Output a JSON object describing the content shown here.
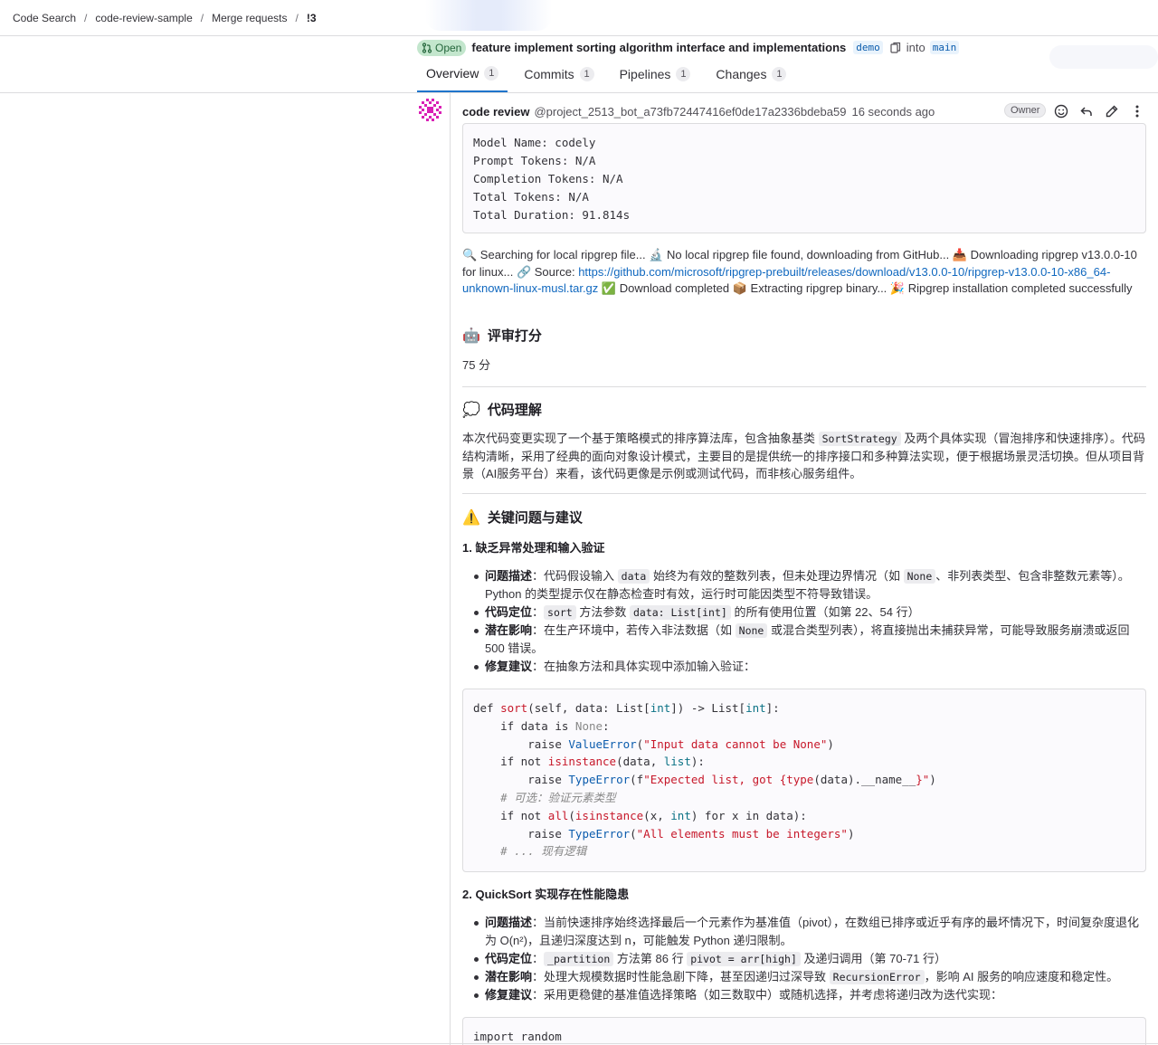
{
  "breadcrumb": [
    "Code Search",
    "code-review-sample",
    "Merge requests",
    "!3"
  ],
  "mr": {
    "state": "Open",
    "title": "feature implement sorting algorithm interface and implementations",
    "source_branch": "demo",
    "into": "into",
    "target_branch": "main"
  },
  "tabs": [
    {
      "label": "Overview",
      "count": "1"
    },
    {
      "label": "Commits",
      "count": "1"
    },
    {
      "label": "Pipelines",
      "count": "1"
    },
    {
      "label": "Changes",
      "count": "1"
    }
  ],
  "note": {
    "author": "code review",
    "handle": "@project_2513_bot_a73fb72447416ef0de17a2336bdeba59",
    "time": "16 seconds ago",
    "role": "Owner",
    "stats": "Model Name: codely\nPrompt Tokens: N/A\nCompletion Tokens: N/A\nTotal Tokens: N/A\nTotal Duration: 91.814s",
    "log": {
      "p1": "🔍 Searching for local ripgrep file... 🔬 No local ripgrep file found, downloading from GitHub... 📥 Downloading ripgrep v13.0.0-10 for linux... 🔗 Source: ",
      "link": "https://github.com/microsoft/ripgrep-prebuilt/releases/download/v13.0.0-10/ripgrep-v13.0.0-10-x86_64-unknown-linux-musl.tar.gz",
      "p2": " ✅ Download completed 📦 Extracting ripgrep binary... 🎉 Ripgrep installation completed successfully"
    },
    "score_heading": "评审打分",
    "score": "75 分",
    "understanding_heading": "代码理解",
    "understanding": {
      "a": "本次代码变更实现了一个基于策略模式的排序算法库，包含抽象基类 ",
      "code": "SortStrategy",
      "b": " 及两个具体实现（冒泡排序和快速排序）。代码结构清晰，采用了经典的面向对象设计模式，主要目的是提供统一的排序接口和多种算法实现，便于根据场景灵活切换。但从项目背景（AI服务平台）来看，该代码更像是示例或测试代码，而非核心服务组件。"
    },
    "issues_heading": "关键问题与建议",
    "issue1": {
      "title": "1. 缺乏异常处理和输入验证",
      "desc_label": "问题描述",
      "desc_a": "：代码假设输入 ",
      "desc_code1": "data",
      "desc_b": " 始终为有效的整数列表，但未处理边界情况（如 ",
      "desc_code2": "None",
      "desc_c": "、非列表类型、包含非整数元素等）。Python 的类型提示仅在静态检查时有效，运行时可能因类型不符导致错误。",
      "loc_label": "代码定位",
      "loc_a": "：",
      "loc_code1": "sort",
      "loc_b": " 方法参数 ",
      "loc_code2": "data: List[int]",
      "loc_c": " 的所有使用位置（如第 22、54 行）",
      "impact_label": "潜在影响",
      "impact_a": "：在生产环境中，若传入非法数据（如 ",
      "impact_code": "None",
      "impact_b": " 或混合类型列表），将直接抛出未捕获异常，可能导致服务崩溃或返回 500 错误。",
      "fix_label": "修复建议",
      "fix_a": "：在抽象方法和具体实现中添加输入验证："
    },
    "code1": [
      "def sort(self, data: List[int]) -> List[int]:",
      "    if data is None:",
      "        raise ValueError(\"Input data cannot be None\")",
      "    if not isinstance(data, list):",
      "        raise TypeError(f\"Expected list, got {type(data).__name__}\")",
      "    # 可选：验证元素类型",
      "    if not all(isinstance(x, int) for x in data):",
      "        raise TypeError(\"All elements must be integers\")",
      "    # ... 现有逻辑"
    ],
    "issue2": {
      "title": "2. QuickSort 实现存在性能隐患",
      "desc_label": "问题描述",
      "desc_a": "：当前快速排序始终选择最后一个元素作为基准值（pivot），在数组已排序或近乎有序的最坏情况下，时间复杂度退化为 O(n²)，且递归深度达到 n，可能触发 Python 递归限制。",
      "loc_label": "代码定位",
      "loc_a": "：",
      "loc_code1": "_partition",
      "loc_b": " 方法第 86 行 ",
      "loc_code2": "pivot = arr[high]",
      "loc_c": " 及递归调用（第 70-71 行）",
      "impact_label": "潜在影响",
      "impact_a": "：处理大规模数据时性能急剧下降，甚至因递归过深导致 ",
      "impact_code": "RecursionError",
      "impact_b": "，影响 AI 服务的响应速度和稳定性。",
      "fix_label": "修复建议",
      "fix_a": "：采用更稳健的基准值选择策略（如三数取中）或随机选择，并考虑将递归改为迭代实现："
    },
    "code2_first": "import random"
  },
  "colors": {
    "accent": "#1f75cb",
    "open_badge": "#c3e6cd",
    "link": "#1068bf"
  }
}
